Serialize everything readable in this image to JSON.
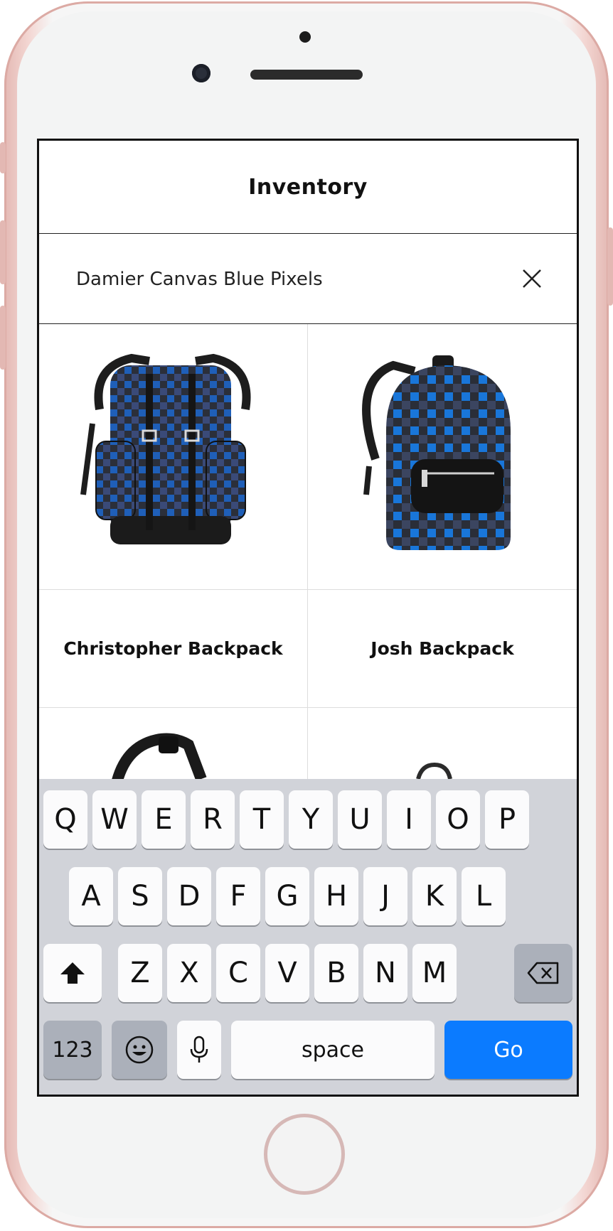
{
  "header": {
    "title": "Inventory"
  },
  "search": {
    "value": "Damier Canvas Blue Pixels"
  },
  "products": [
    {
      "name": "Christopher Backpack"
    },
    {
      "name": "Josh Backpack"
    }
  ],
  "keyboard": {
    "row1": [
      "Q",
      "W",
      "E",
      "R",
      "T",
      "Y",
      "U",
      "I",
      "O",
      "P"
    ],
    "row2": [
      "A",
      "S",
      "D",
      "F",
      "G",
      "H",
      "J",
      "K",
      "L"
    ],
    "row3": [
      "Z",
      "X",
      "C",
      "V",
      "B",
      "N",
      "M"
    ],
    "numbers_label": "123",
    "space_label": "space",
    "go_label": "Go"
  },
  "colors": {
    "accent": "#0b7bff",
    "keyboard_bg": "#d1d3d9",
    "key_bg": "#fbfbfc",
    "key_dark_bg": "#abb0ba",
    "bag_blue": "#1f5fb8",
    "bag_dark": "#2b2f3a"
  },
  "icons": {
    "clear": "close-icon",
    "shift": "shift-icon",
    "delete": "backspace-icon",
    "emoji": "emoji-icon",
    "mic": "microphone-icon"
  }
}
